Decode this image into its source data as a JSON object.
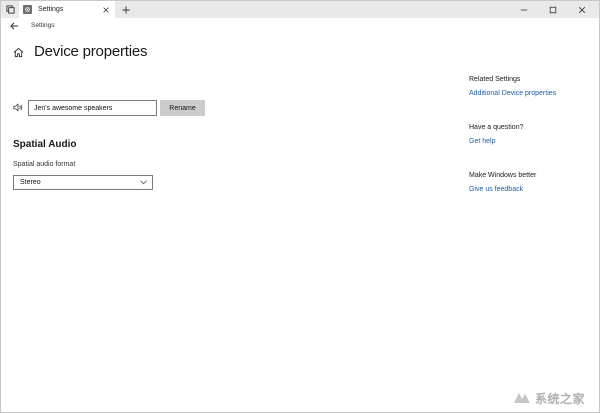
{
  "window": {
    "tab_title": "Settings",
    "nav_title": "Settings"
  },
  "page": {
    "title": "Device properties"
  },
  "device": {
    "name_value": "Jen's awesome speakers",
    "rename_label": "Rename"
  },
  "spatial_audio": {
    "heading": "Spatial Audio",
    "format_label": "Spatial audio format",
    "format_value": "Stereo"
  },
  "sidebar": {
    "related_heading": "Related Settings",
    "related_link": "Additional Device properties",
    "question_heading": "Have a question?",
    "question_link": "Get help",
    "feedback_heading": "Make Windows better",
    "feedback_link": "Give us feedback"
  },
  "watermark": {
    "text": "系统之家"
  },
  "colors": {
    "link": "#1f5ea8",
    "titlebar": "#e9e9e9",
    "button": "#cccccc"
  },
  "icons": [
    "tab-list-icon",
    "settings-gear-icon",
    "close-icon",
    "plus-icon",
    "minimize-icon",
    "maximize-icon",
    "back-arrow-icon",
    "home-icon",
    "speaker-icon",
    "chevron-down-icon"
  ]
}
